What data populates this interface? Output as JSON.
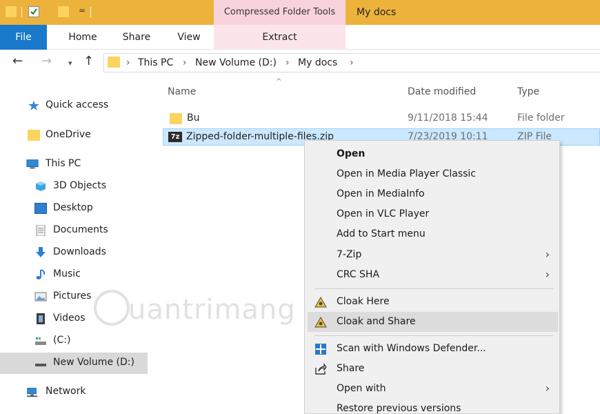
{
  "titlebar": {
    "dropdown_glyph": "=",
    "contextual_tab_label": "Compressed Folder Tools",
    "window_title": "My docs",
    "accent_color": "#ecb23b",
    "contextual_color": "#f9d3dc"
  },
  "ribbon": {
    "tabs": [
      "File",
      "Home",
      "Share",
      "View",
      "Extract"
    ],
    "file_tab_color": "#1979ca"
  },
  "address": {
    "back_icon": "arrow-left-icon",
    "forward_icon": "arrow-right-icon",
    "recent_icon": "chevron-down-icon",
    "up_icon": "arrow-up-icon",
    "crumbs": [
      "This PC",
      "New Volume (D:)",
      "My docs"
    ]
  },
  "nav": {
    "items": [
      {
        "label": "Quick access",
        "icon": "star-icon"
      },
      {
        "label": "OneDrive",
        "icon": "folder-icon"
      },
      {
        "label": "This PC",
        "icon": "computer-icon"
      },
      {
        "label": "3D Objects",
        "icon": "cube-icon"
      },
      {
        "label": "Desktop",
        "icon": "desktop-icon"
      },
      {
        "label": "Documents",
        "icon": "document-icon"
      },
      {
        "label": "Downloads",
        "icon": "download-icon"
      },
      {
        "label": "Music",
        "icon": "music-note-icon"
      },
      {
        "label": "Pictures",
        "icon": "picture-icon"
      },
      {
        "label": "Videos",
        "icon": "film-icon"
      },
      {
        "label": "(C:)",
        "icon": "drive-icon"
      },
      {
        "label": "New Volume (D:)",
        "icon": "drive-icon",
        "selected": true
      },
      {
        "label": "Network",
        "icon": "network-icon"
      }
    ]
  },
  "files": {
    "columns": [
      "Name",
      "Date modified",
      "Type"
    ],
    "rows": [
      {
        "name": "Bu",
        "date": "9/11/2018 15:44",
        "type": "File folder",
        "icon": "folder-icon"
      },
      {
        "name": "Zipped-folder-multiple-files.zip",
        "date": "7/23/2019 10:11",
        "type": "ZIP File",
        "icon": "7zip-icon",
        "selected": true
      }
    ]
  },
  "watermark": {
    "text": "uantrimang"
  },
  "context_menu": {
    "items": [
      {
        "label": "Open",
        "bold": true
      },
      {
        "label": "Open in Media Player Classic"
      },
      {
        "label": "Open in MediaInfo"
      },
      {
        "label": "Open in VLC Player"
      },
      {
        "label": "Add to Start menu"
      },
      {
        "label": "7-Zip",
        "submenu": true
      },
      {
        "label": "CRC SHA",
        "submenu": true
      },
      {
        "label": "Cloak Here",
        "icon": "cloak-icon"
      },
      {
        "label": "Cloak and Share",
        "icon": "cloak-icon",
        "hover": true
      },
      {
        "label": "Scan with Windows Defender...",
        "icon": "defender-icon"
      },
      {
        "label": "Share",
        "icon": "share-icon"
      },
      {
        "label": "Open with",
        "submenu": true
      },
      {
        "label": "Restore previous versions"
      }
    ],
    "submenu_glyph": "›"
  }
}
